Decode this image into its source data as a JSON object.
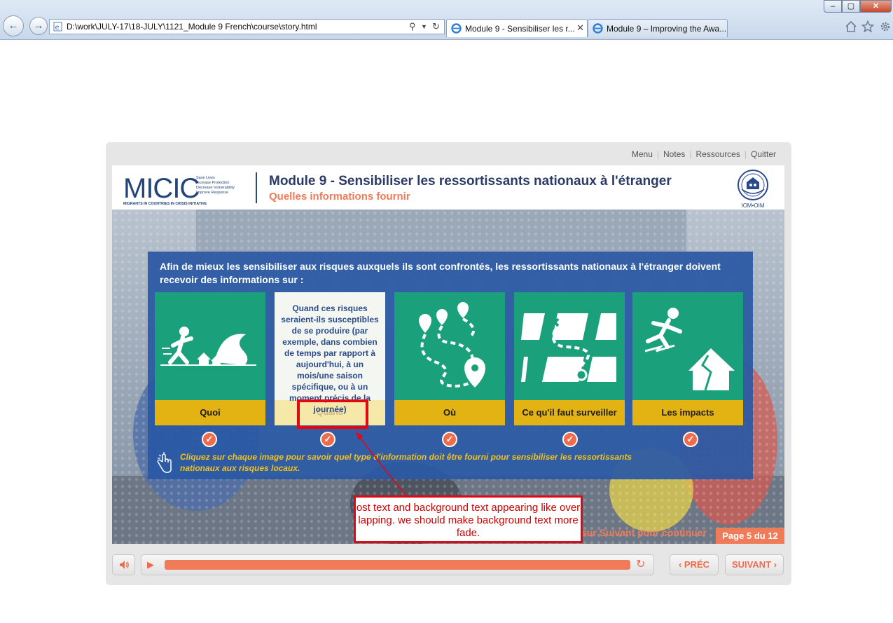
{
  "browser": {
    "address": "D:\\work\\JULY-17\\18-JULY\\1121_Module 9 French\\course\\story.html",
    "tabs": [
      {
        "label": "Module 9 - Sensibiliser les r...",
        "active": true
      },
      {
        "label": "Module 9 – Improving the Awa...",
        "active": false
      }
    ],
    "window_controls": {
      "minimize": "–",
      "maximize": "▢",
      "close": "✕"
    }
  },
  "player": {
    "top_links": [
      "Menu",
      "Notes",
      "Ressources",
      "Quitter"
    ],
    "slide": {
      "logo_text": "MICIC",
      "logo_tagline": [
        "Save Lives",
        "Increase Protection",
        "Decrease Vulnerability",
        "Improve Response"
      ],
      "logo_footer": "MIGRANTS IN COUNTRIES IN CRISIS INITIATIVE",
      "module_title": "Module 9 - Sensibiliser les ressortissants nationaux à l'étranger",
      "module_subtitle": "Quelles informations fournir",
      "iom_label": "IOM•OIM",
      "intro_text": "Afin de mieux les sensibiliser aux risques auxquels ils sont confrontés, les ressortissants nationaux à l'étranger doivent recevoir des informations sur :",
      "cards": [
        {
          "label": "Quoi",
          "icon": "running-from-wave-icon"
        },
        {
          "label": "Quand",
          "icon": "",
          "overlay_text": "Quand ces risques seraient-ils susceptibles de se produire (par exemple, dans combien de temps par rapport à aujourd'hui, à un mois/une saison spécifique, ou à un moment précis de la journée)"
        },
        {
          "label": "Où",
          "icon": "map-route-pins-icon"
        },
        {
          "label": "Ce qu'il faut surveiller",
          "icon": "map-path-x-icon"
        },
        {
          "label": "Les impacts",
          "icon": "earthquake-house-icon"
        }
      ],
      "hint_text": "Cliquez sur chaque image pour savoir quel type d'information doit être fourni pour sensibiliser les ressortissants nationaux aux risques locaux.",
      "continue_text": "sur Suivant pour continuer",
      "page_counter": "Page 5 du 12"
    },
    "controls": {
      "progress": 1.0,
      "prev_label": "PRÉC",
      "next_label": "SUIVANT"
    }
  },
  "annotation": {
    "text": "ost text and background text appearing like over lapping. we should make background text more fade.",
    "color": "#e30613"
  },
  "colors": {
    "card_green": "#1aa07a",
    "card_yellow": "#e2b312",
    "panel_blue": "#2a58a4",
    "accent_orange": "#f07b58",
    "title_navy": "#2b3b66"
  }
}
